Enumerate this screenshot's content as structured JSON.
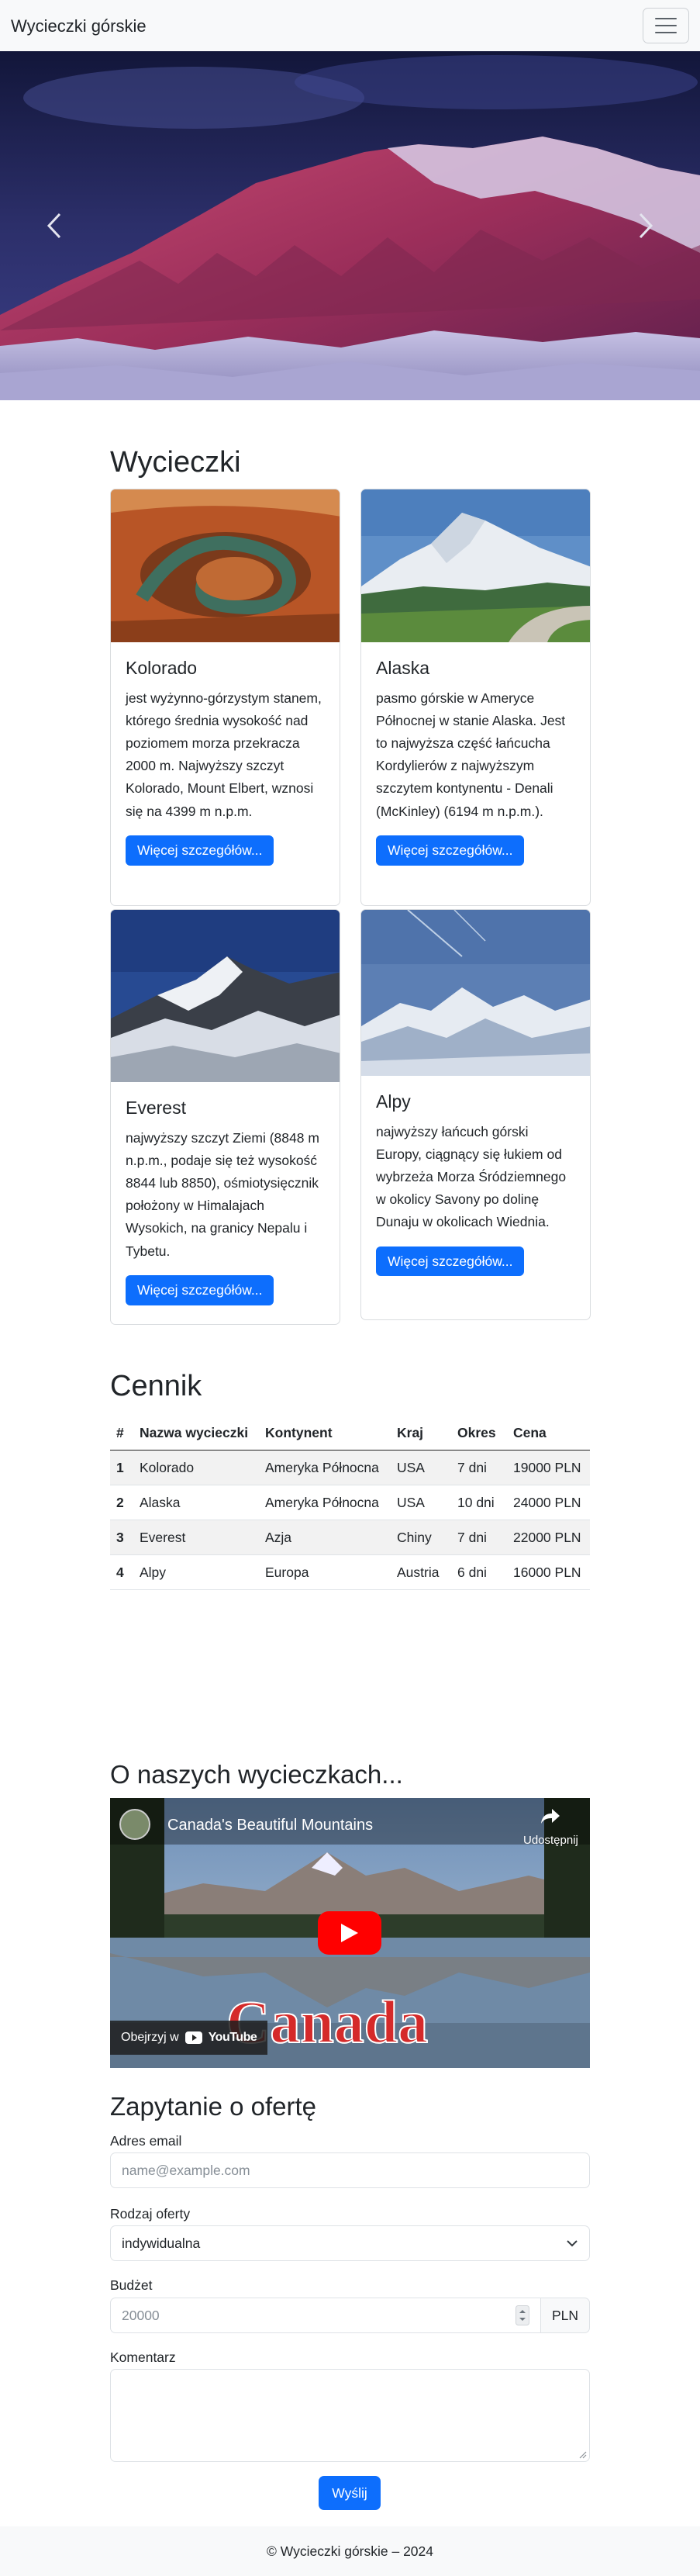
{
  "navbar": {
    "brand": "Wycieczki górskie",
    "toggler_icon": "hamburger-icon"
  },
  "carousel": {
    "prev_icon": "chevron-left-icon",
    "next_icon": "chevron-right-icon"
  },
  "tours": {
    "title": "Wycieczki",
    "cards": [
      {
        "title": "Kolorado",
        "text": "jest wyżynno-górzystym stanem, którego średnia wysokość nad poziomem morza przekracza 2000 m. Najwyższy szczyt Kolorado, Mount Elbert, wznosi się na 4399 m n.p.m.",
        "button": "Więcej szczegółów..."
      },
      {
        "title": "Alaska",
        "text": "pasmo górskie w Ameryce Północnej w stanie Alaska. Jest to najwyższa część łańcucha Kordylierów z najwyższym szczytem kontynentu - Denali (McKinley) (6194 m n.p.m.).",
        "button": "Więcej szczegółów..."
      },
      {
        "title": "Everest",
        "text": "najwyższy szczyt Ziemi (8848 m n.p.m., podaje się też wysokość 8844 lub 8850), ośmiotysięcznik położony w Himalajach Wysokich, na granicy Nepalu i Tybetu.",
        "button": "Więcej szczegółów..."
      },
      {
        "title": "Alpy",
        "text": "najwyższy łańcuch górski Europy, ciągnący się łukiem od wybrzeża Morza Śródziemnego w okolicy Savony po dolinę Dunaju w okolicach Wiednia.",
        "button": "Więcej szczegółów..."
      }
    ]
  },
  "pricing": {
    "title": "Cennik",
    "headers": [
      "#",
      "Nazwa wycieczki",
      "Kontynent",
      "Kraj",
      "Okres",
      "Cena"
    ],
    "rows": [
      [
        "1",
        "Kolorado",
        "Ameryka Północna",
        "USA",
        "7 dni",
        "19000 PLN"
      ],
      [
        "2",
        "Alaska",
        "Ameryka Północna",
        "USA",
        "10 dni",
        "24000 PLN"
      ],
      [
        "3",
        "Everest",
        "Azja",
        "Chiny",
        "7 dni",
        "22000 PLN"
      ],
      [
        "4",
        "Alpy",
        "Europa",
        "Austria",
        "6 dni",
        "16000 PLN"
      ]
    ]
  },
  "about": {
    "title": "O naszych wycieczkach...",
    "video": {
      "title": "Canada's Beautiful Mountains",
      "share_label": "Udostępnij",
      "watch_on": "Obejrzyj w",
      "youtube_label": "YouTube",
      "overlay_word": "Canada"
    }
  },
  "form": {
    "title": "Zapytanie o ofertę",
    "email_label": "Adres email",
    "email_placeholder": "name@example.com",
    "offer_label": "Rodzaj oferty",
    "offer_value": "indywidualna",
    "budget_label": "Budżet",
    "budget_placeholder": "20000",
    "currency": "PLN",
    "comment_label": "Komentarz",
    "submit": "Wyślij"
  },
  "footer": {
    "text": "© Wycieczki górskie – 2024"
  },
  "colors": {
    "primary": "#0d6efd",
    "navbar_bg": "#f8f9fa",
    "stripe": "#f2f2f2"
  }
}
